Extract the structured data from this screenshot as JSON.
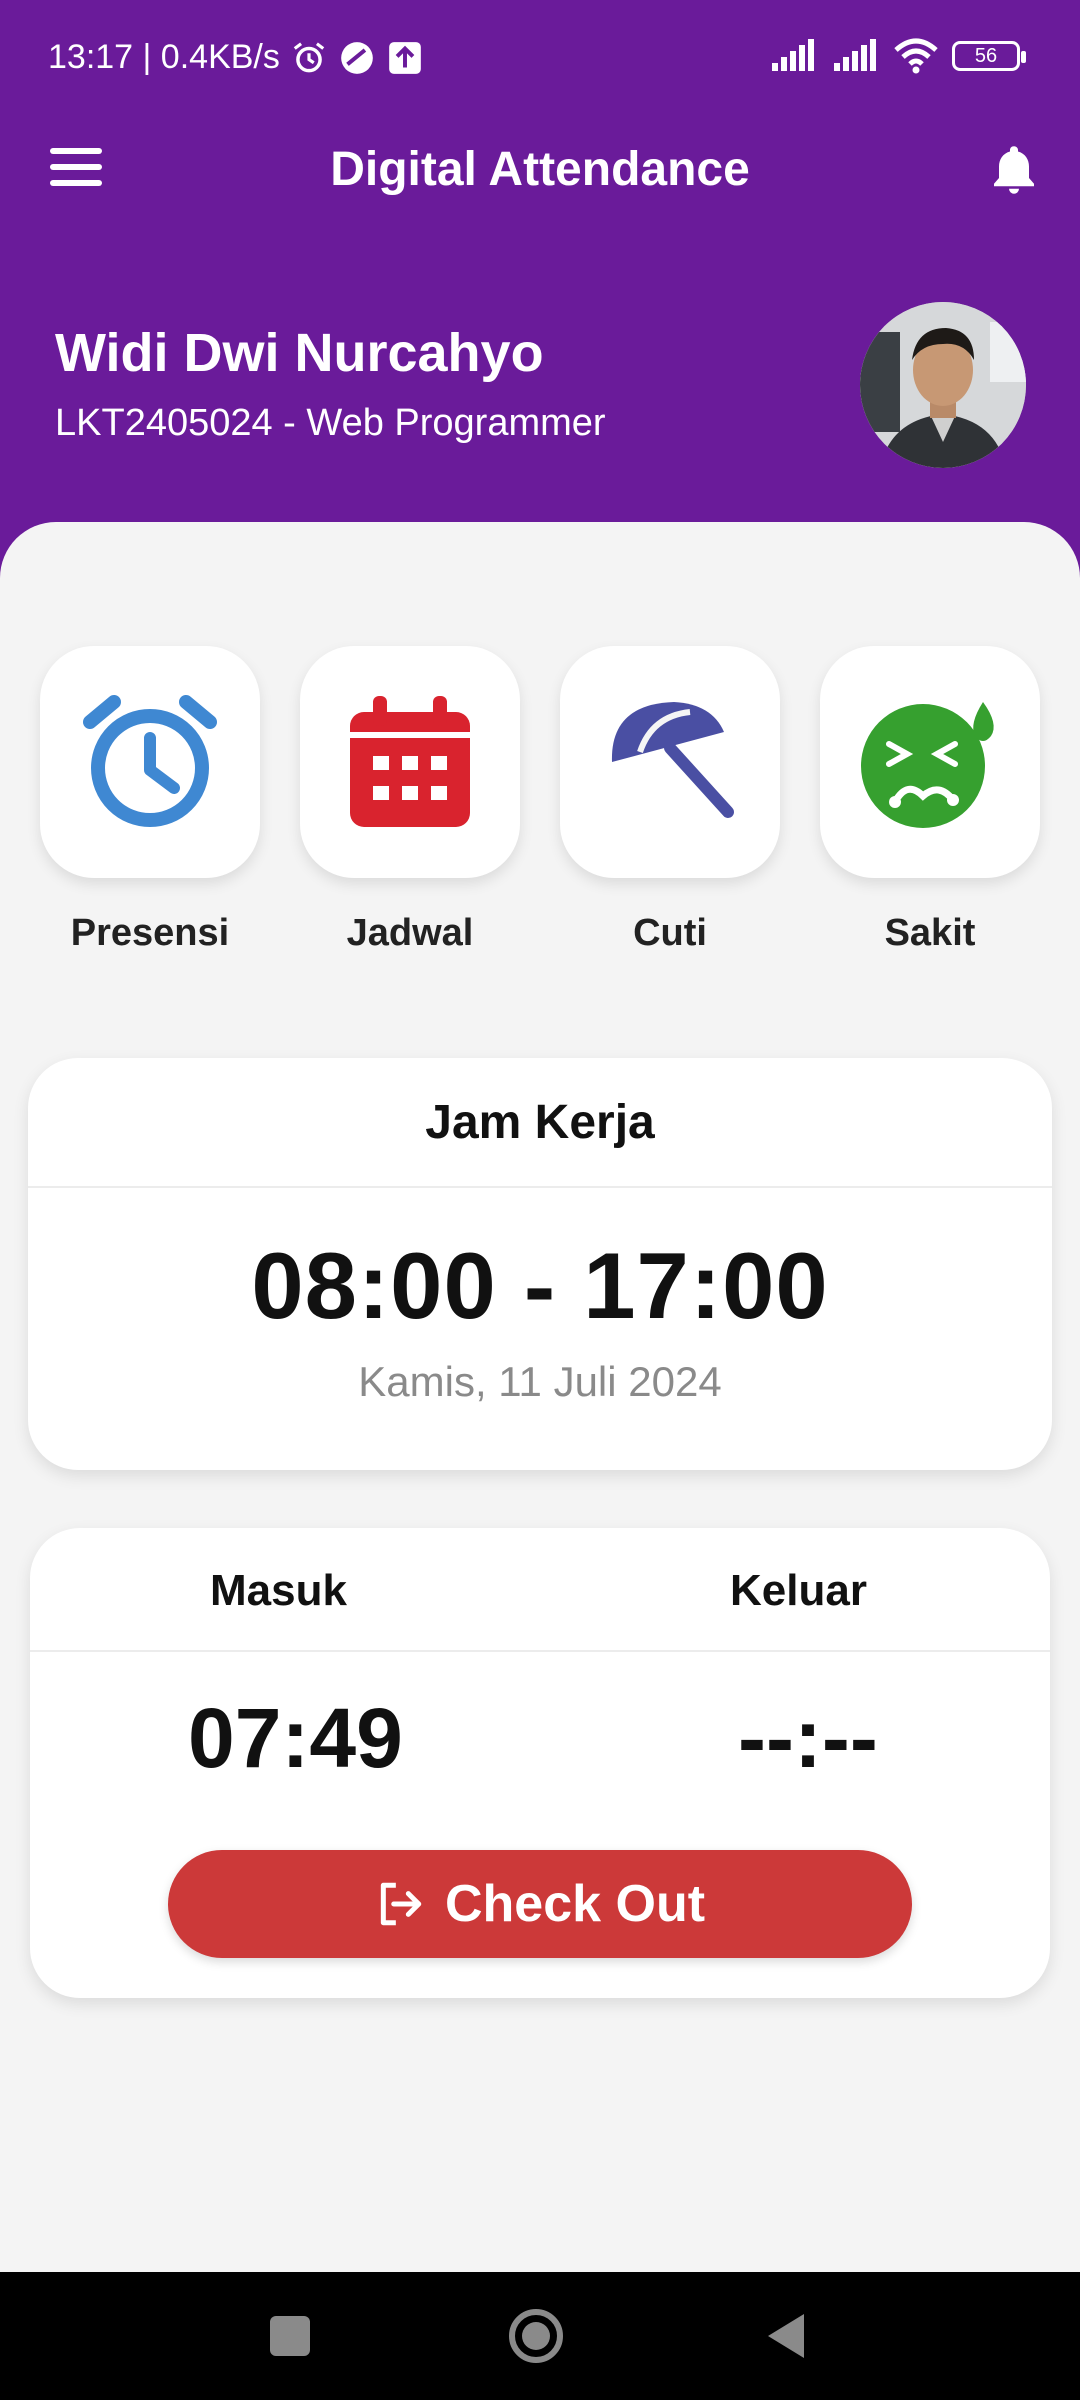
{
  "status_bar": {
    "time_speed": "13:17 | 0.4KB/s",
    "battery": "56"
  },
  "app_bar": {
    "title": "Digital Attendance",
    "menu_icon": "hamburger-menu-icon",
    "notification_icon": "bell-icon"
  },
  "profile": {
    "name": "Widi Dwi Nurcahyo",
    "subtitle": "LKT2405024 - Web Programmer"
  },
  "quick_menu": {
    "items": [
      {
        "label": "Presensi",
        "icon": "alarm-clock-icon",
        "color": "#3f88d2"
      },
      {
        "label": "Jadwal",
        "icon": "calendar-icon",
        "color": "#d9232e"
      },
      {
        "label": "Cuti",
        "icon": "umbrella-icon",
        "color": "#4a4fa3"
      },
      {
        "label": "Sakit",
        "icon": "sick-face-icon",
        "color": "#36a02f"
      }
    ]
  },
  "work_hours": {
    "heading": "Jam Kerja",
    "hours": "08:00 - 17:00",
    "date": "Kamis, 11 Juli 2024"
  },
  "attendance": {
    "in_label": "Masuk",
    "out_label": "Keluar",
    "in_time": "07:49",
    "out_time": "--:--",
    "checkout_label": "Check Out"
  },
  "colors": {
    "primary": "#6a1b9a",
    "checkout": "#cc3939"
  }
}
